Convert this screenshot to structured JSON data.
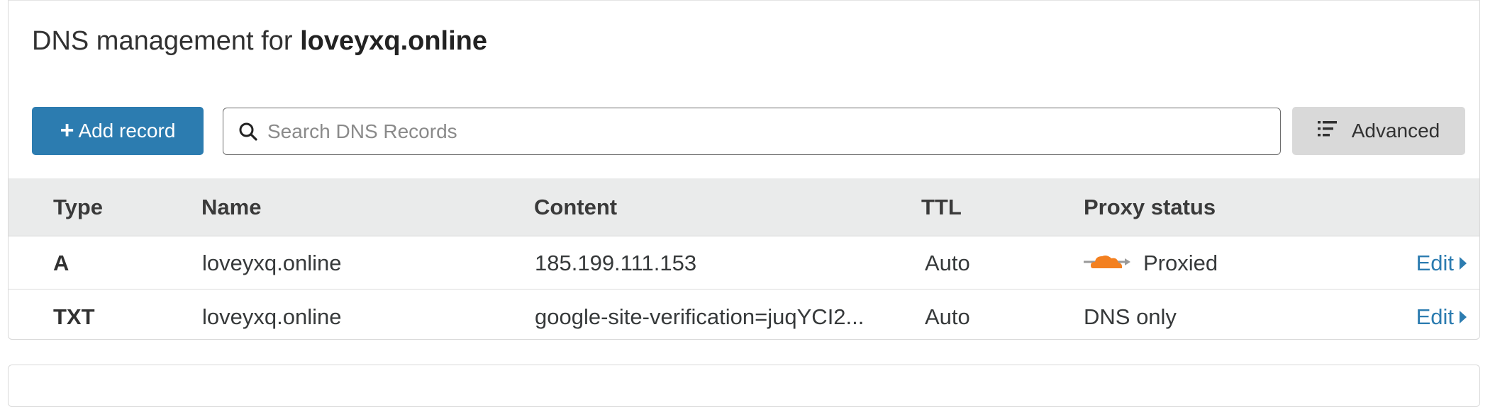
{
  "header": {
    "title_prefix": "DNS management for ",
    "domain": "loveyxq.online"
  },
  "toolbar": {
    "add_label": "Add record",
    "add_plus": "+",
    "search_placeholder": "Search DNS Records",
    "advanced_label": "Advanced"
  },
  "table": {
    "columns": [
      "Type",
      "Name",
      "Content",
      "TTL",
      "Proxy status"
    ],
    "rows": [
      {
        "type": "A",
        "name": "loveyxq.online",
        "content": "185.199.111.153",
        "ttl": "Auto",
        "proxy": "Proxied",
        "proxy_icon": "orange-cloud-icon",
        "edit": "Edit"
      },
      {
        "type": "TXT",
        "name": "loveyxq.online",
        "content": "google-site-verification=juqYCI2...",
        "ttl": "Auto",
        "proxy": "DNS only",
        "edit": "Edit"
      }
    ]
  },
  "colors": {
    "accent": "#2c7cb0",
    "cloud": "#f38020",
    "header_bg": "#eaebeb"
  }
}
